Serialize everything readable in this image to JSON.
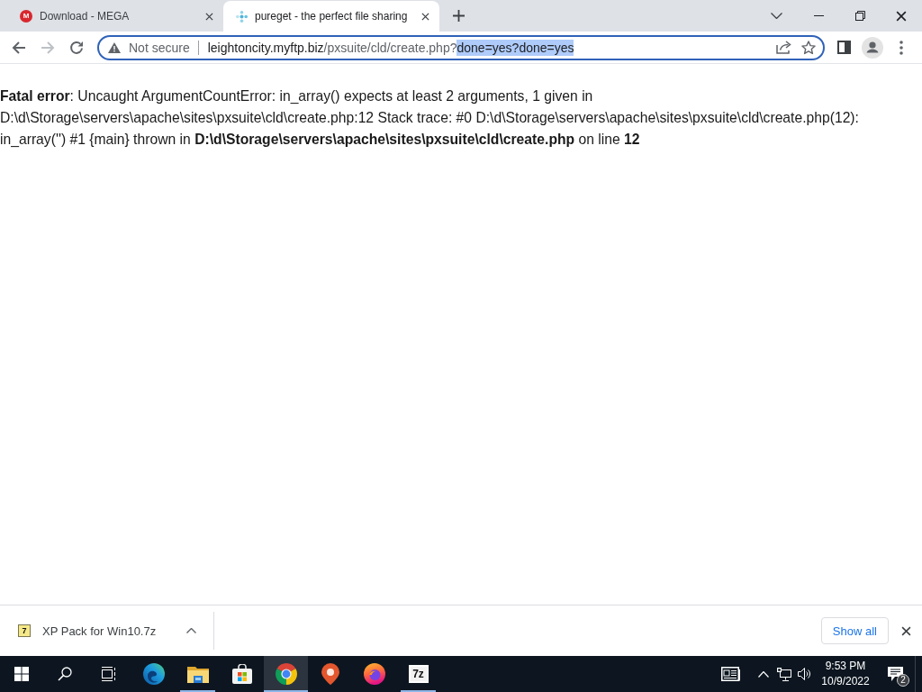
{
  "browser": {
    "tabs": [
      {
        "title": "Download - MEGA",
        "favicon": {
          "kind": "letter",
          "text": "M"
        },
        "selected": false
      },
      {
        "title": "pureget - the perfect file sharing",
        "favicon": {
          "kind": "dots"
        },
        "selected": true
      }
    ]
  },
  "toolbar": {
    "nav_buttons": [
      {
        "kind": "back",
        "disabled": false
      },
      {
        "kind": "forward",
        "disabled": true
      },
      {
        "kind": "reload",
        "disabled": false
      }
    ],
    "address_bar": {
      "focused": true,
      "security_label": "Not secure",
      "url_parts": [
        {
          "kind": "host",
          "text": "leightoncity.myftp.biz",
          "selected": false
        },
        {
          "kind": "path",
          "text": "/pxsuite/cld/create.php?",
          "selected": false
        },
        {
          "kind": "path",
          "text": "done=yes?done=yes",
          "selected": true
        }
      ]
    }
  },
  "page": {
    "error_message": "**Fatal error**: Uncaught ArgumentCountError: in_array() expects at least 2 arguments, 1 given in D:\\d\\Storage\\servers\\apache\\sites\\pxsuite\\cld\\create.php:12 Stack trace: #0 D:\\d\\Storage\\servers\\apache\\sites\\pxsuite\\cld\\create.php(12): in_array('') #1 {main} thrown in **D:\\d\\Storage\\servers\\apache\\sites\\pxsuite\\cld\\create.php** on line **12**"
  },
  "download_shelf": {
    "items": [
      {
        "file_name": "XP Pack for Win10.7z",
        "icon_label": "7"
      }
    ],
    "show_all_button": "Show all"
  },
  "taskbar": {
    "apps": [
      {
        "kind": "edge",
        "running": false,
        "selected": false
      },
      {
        "kind": "explorer",
        "running": true,
        "selected": false
      },
      {
        "kind": "store",
        "running": false,
        "selected": false
      },
      {
        "kind": "chrome",
        "running": true,
        "selected": true
      },
      {
        "kind": "maps",
        "running": false,
        "selected": false
      },
      {
        "kind": "firefox",
        "running": false,
        "selected": false
      },
      {
        "kind": "archiver",
        "label": "7z",
        "running": true,
        "selected": false
      }
    ],
    "clock": {
      "time": "9:53 PM",
      "date": "10/9/2022"
    },
    "notification_count": "2"
  }
}
